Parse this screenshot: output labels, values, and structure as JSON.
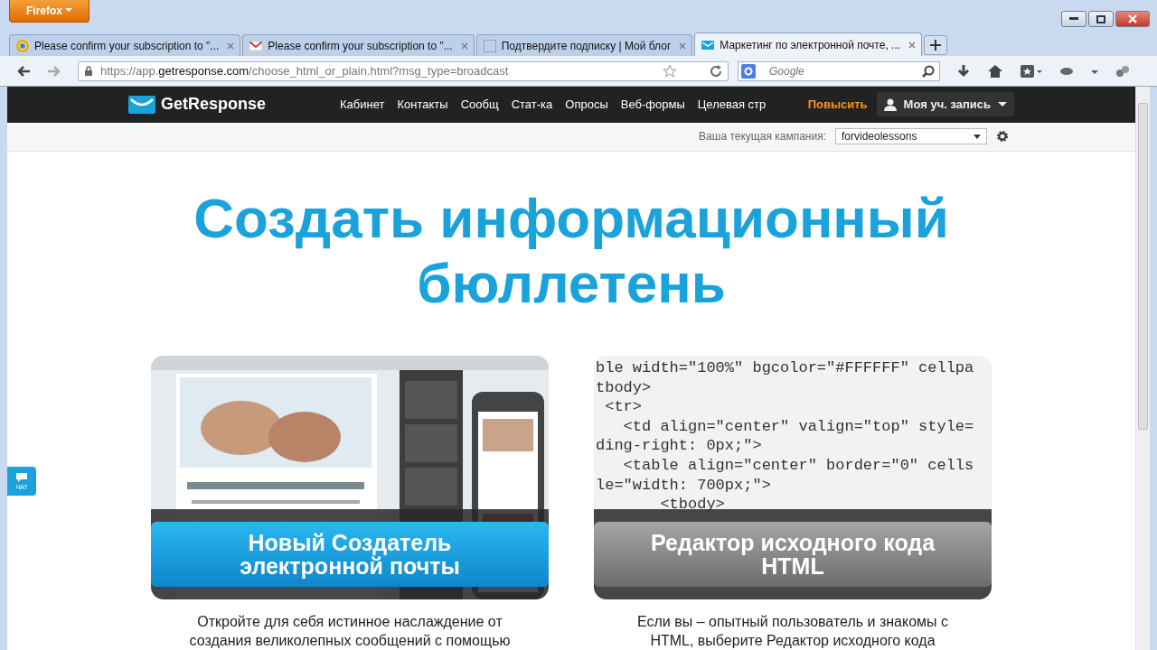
{
  "browser": {
    "menu_button": "Firefox",
    "tabs": [
      {
        "title": "Please confirm your subscription to \"...",
        "selected": false
      },
      {
        "title": "Please confirm your subscription to \"...",
        "selected": false
      },
      {
        "title": "Подтвердите подписку | Мой блог",
        "selected": false
      },
      {
        "title": "Маркетинг по электронной почте, ...",
        "selected": true
      }
    ],
    "url_prefix": "https://app.",
    "url_domain": "getresponse.com",
    "url_rest": "/choose_html_or_plain.html?msg_type=broadcast",
    "search": {
      "placeholder": "Google"
    }
  },
  "header": {
    "logo": "GetResponse",
    "nav": [
      "Кабинет",
      "Контакты",
      "Сообщ",
      "Стат-ка",
      "Опросы",
      "Веб-формы",
      "Целевая стр"
    ],
    "upgrade": "Повысить",
    "account": "Моя уч. запись"
  },
  "campaign": {
    "label": "Ваша текущая кампания:",
    "value": "forvideolessons"
  },
  "title": "Создать информационный бюллетень",
  "chat": "ЧАТ",
  "options": [
    {
      "kind": "picture",
      "button": "Новый Создатель электронной почты",
      "description": [
        "Откройте для себя истинное наслаждение от",
        "создания великолепных сообщений с помощью"
      ]
    },
    {
      "kind": "code",
      "button": "Редактор исходного кода HTML",
      "code": [
        "ble width=\"100%\" bgcolor=\"#FFFFFF\" cellpa",
        "tbody>",
        " <tr>",
        "   <td align=\"center\" valign=\"top\" style=",
        "ding-right: 0px;\">",
        "   <table align=\"center\" border=\"0\" cells",
        "le=\"width: 700px;\">",
        "       <tbody>"
      ],
      "description": [
        "Если вы – опытный пользователь и знакомы с",
        "HTML, выберите Редактор исходного кода"
      ]
    }
  ]
}
